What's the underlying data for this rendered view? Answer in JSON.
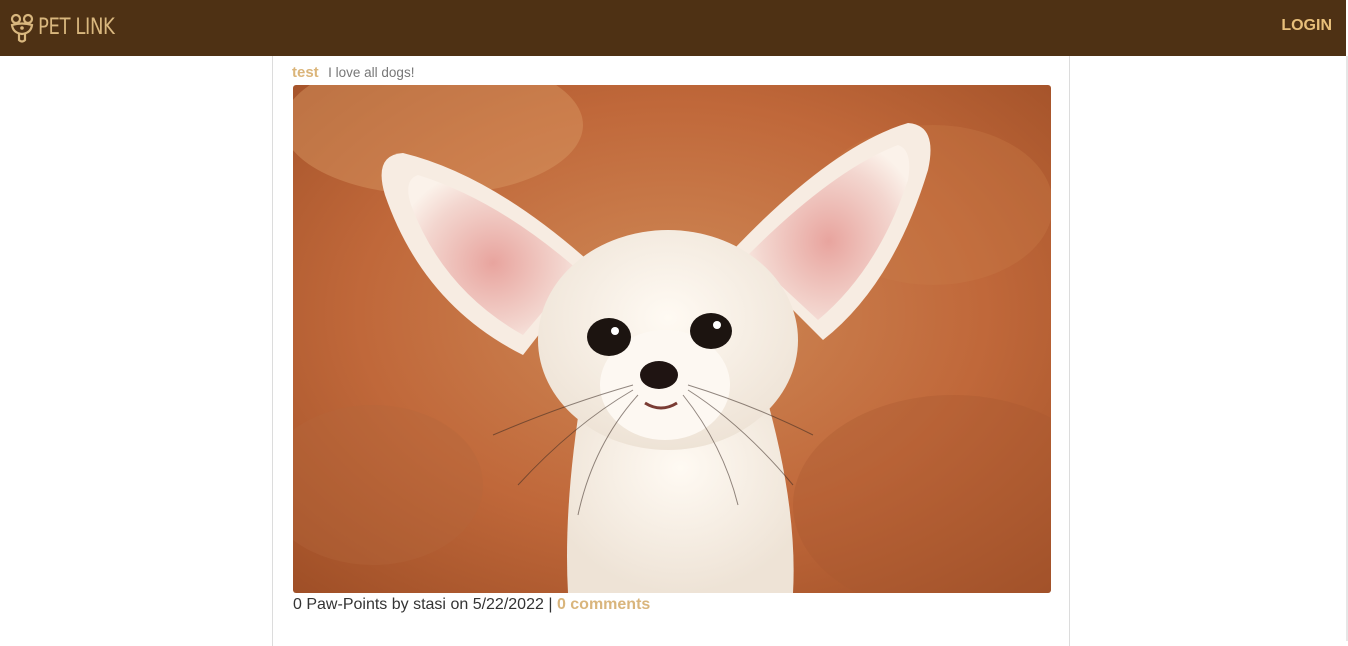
{
  "nav": {
    "brand_name": "PET LINK",
    "brand_icon": "paw-face-logo",
    "login_label": "LOGIN"
  },
  "post": {
    "title": "test",
    "caption": "I love all dogs!",
    "image_subject": "fennec-fox-photo",
    "paw_points": "0",
    "paw_points_label": "Paw-Points by",
    "author": "stasi",
    "date_prefix": "on",
    "date": "5/22/2022",
    "separator": "|",
    "comments_label": "0 comments"
  },
  "colors": {
    "navbar_bg": "#4e3114",
    "accent": "#dbb57a"
  }
}
